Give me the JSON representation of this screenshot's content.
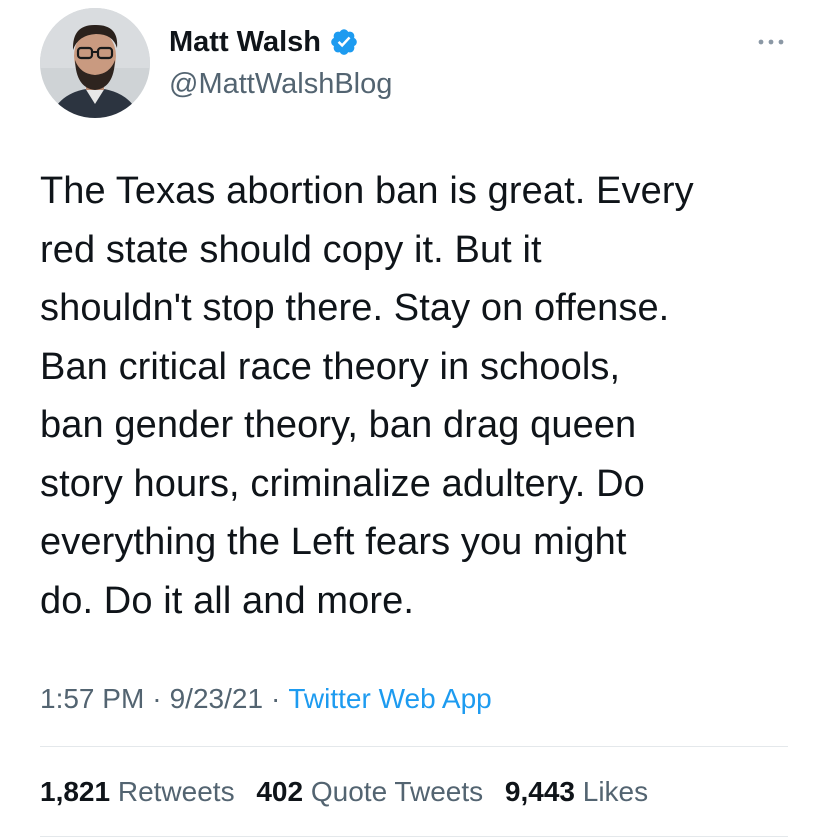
{
  "user": {
    "display_name": "Matt Walsh",
    "handle": "@MattWalshBlog",
    "verified": true
  },
  "icons": {
    "avatar": "profile-photo",
    "verified": "verified-badge-icon",
    "more": "more-options-icon"
  },
  "colors": {
    "verified_blue": "#1d9bf0",
    "link_blue": "#1d9bf0",
    "secondary_text": "#536471",
    "primary_text": "#0f1419"
  },
  "tweet": {
    "lines": [
      "The Texas abortion ban is great. Every",
      "red state should copy it. But it",
      "shouldn't stop there. Stay on offense.",
      "Ban critical race theory in schools,",
      "ban gender theory, ban drag queen",
      "story hours, criminalize adultery. Do",
      "everything the Left fears you might",
      "do. Do it all and more."
    ],
    "time": "1:57 PM",
    "date": "9/23/21",
    "separator": "·",
    "source": "Twitter Web App"
  },
  "stats": {
    "retweets_count": "1,821",
    "retweets_label": "Retweets",
    "quotes_count": "402",
    "quotes_label": "Quote Tweets",
    "likes_count": "9,443",
    "likes_label": "Likes"
  }
}
